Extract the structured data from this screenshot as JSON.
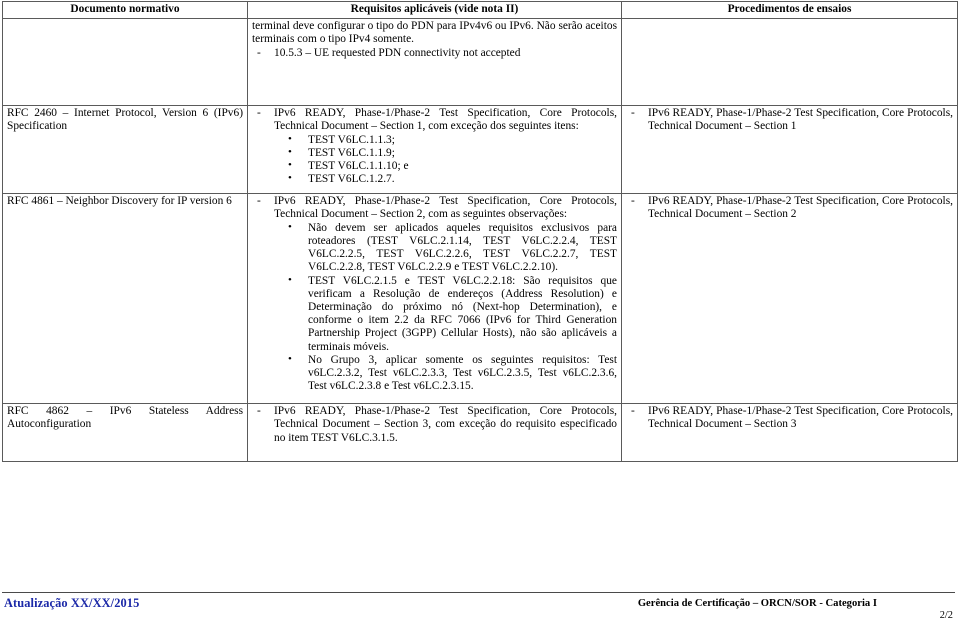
{
  "table": {
    "headers": {
      "col1": "Documento normativo",
      "col2": "Requisitos aplicáveis (vide nota II)",
      "col3": "Procedimentos de ensaios"
    },
    "rows": [
      {
        "doc": "",
        "req": {
          "intro_lines": [
            "terminal deve configurar o tipo do PDN para IPv4v6 ou IPv6. Não serão aceitos terminais com o tipo IPv4 somente."
          ],
          "dash_items": [
            "10.5.3 – UE requested PDN connectivity not accepted"
          ],
          "dot_items": []
        },
        "proc": ""
      },
      {
        "doc": "RFC 2460 – Internet Protocol, Version 6 (IPv6) Specification",
        "req": {
          "intro_lines": [],
          "dash_items": [
            "IPv6 READY, Phase-1/Phase-2 Test Specification, Core Protocols, Technical Document – Section 1, com exceção dos seguintes itens:"
          ],
          "dot_items": [
            "TEST V6LC.1.1.3;",
            "TEST V6LC.1.1.9;",
            "TEST V6LC.1.1.10; e",
            "TEST V6LC.1.2.7."
          ]
        },
        "proc": "IPv6 READY, Phase-1/Phase-2 Test Specification, Core Protocols, Technical Document – Section 1"
      },
      {
        "doc": "RFC 4861 – Neighbor Discovery for IP version 6",
        "req": {
          "intro_lines": [],
          "dash_items": [
            "IPv6 READY, Phase-1/Phase-2 Test Specification, Core Protocols, Technical Document – Section 2, com as seguintes observações:"
          ],
          "dot_items": [
            "Não devem ser aplicados aqueles requisitos exclusivos para roteadores (TEST V6LC.2.1.14, TEST V6LC.2.2.4, TEST V6LC.2.2.5, TEST V6LC.2.2.6, TEST V6LC.2.2.7, TEST V6LC.2.2.8, TEST V6LC.2.2.9 e TEST V6LC.2.2.10).",
            "TEST V6LC.2.1.5 e TEST V6LC.2.2.18: São requisitos que verificam a Resolução de endereços (Address Resolution) e Determinação do próximo nó (Next-hop Determination), e conforme o item 2.2 da RFC 7066 (IPv6 for Third Generation Partnership Project (3GPP) Cellular Hosts), não são aplicáveis a terminais móveis.",
            "No Grupo 3, aplicar somente os seguintes requisitos: Test v6LC.2.3.2, Test v6LC.2.3.3, Test v6LC.2.3.5, Test v6LC.2.3.6, Test v6LC.2.3.8 e Test v6LC.2.3.15."
          ]
        },
        "proc": "IPv6 READY, Phase-1/Phase-2 Test Specification, Core Protocols, Technical Document – Section 2"
      },
      {
        "doc": "RFC 4862 – IPv6 Stateless Address Autoconfiguration",
        "req": {
          "intro_lines": [],
          "dash_items": [
            "IPv6 READY, Phase-1/Phase-2 Test Specification, Core Protocols, Technical Document – Section 3, com exceção do requisito especificado no item TEST V6LC.3.1.5."
          ],
          "dot_items": []
        },
        "proc": "IPv6 READY, Phase-1/Phase-2 Test Specification, Core Protocols, Technical Document – Section 3"
      }
    ]
  },
  "footer": {
    "left": "Atualização XX/XX/2015",
    "right": "Gerência de Certificação – ORCN/SOR - Categoria I",
    "page": "2/2",
    "left_color": "#1c29a8"
  }
}
